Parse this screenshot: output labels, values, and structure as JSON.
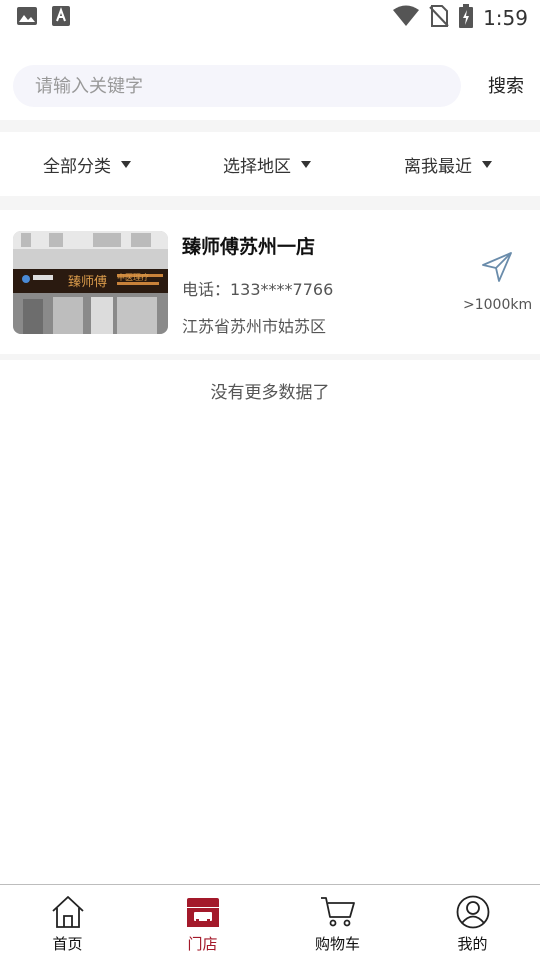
{
  "status_bar": {
    "time": "1:59",
    "left_icons": [
      "image-icon",
      "font-a-icon"
    ],
    "right_icons": [
      "wifi-icon",
      "no-sim-icon",
      "battery-charging-icon"
    ]
  },
  "search": {
    "placeholder": "请输入关键字",
    "value": "",
    "button_label": "搜索"
  },
  "filters": [
    {
      "label": "全部分类"
    },
    {
      "label": "选择地区"
    },
    {
      "label": "离我最近"
    }
  ],
  "stores": [
    {
      "name": "臻师傅苏州一店",
      "phone": "电话：133****7766",
      "address": "江苏省苏州市姑苏区",
      "distance": ">1000km",
      "sign_text": "臻师傅",
      "sign_sub": "中医理疗"
    }
  ],
  "list_footer": "没有更多数据了",
  "tab_bar": {
    "active_color": "#a3192a",
    "items": [
      {
        "label": "首页",
        "icon": "home-icon",
        "active": false
      },
      {
        "label": "门店",
        "icon": "store-icon",
        "active": true
      },
      {
        "label": "购物车",
        "icon": "cart-icon",
        "active": false
      },
      {
        "label": "我的",
        "icon": "user-icon",
        "active": false
      }
    ]
  }
}
